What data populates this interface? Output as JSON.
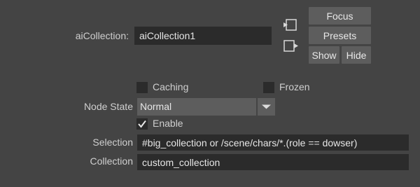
{
  "collection_name": {
    "label": "aiCollection:",
    "value": "aiCollection1"
  },
  "side_buttons": {
    "focus": "Focus",
    "presets": "Presets",
    "show": "Show",
    "hide": "Hide"
  },
  "checkboxes": {
    "caching": {
      "label": "Caching",
      "checked": false
    },
    "frozen": {
      "label": "Frozen",
      "checked": false
    },
    "enable": {
      "label": "Enable",
      "checked": true
    }
  },
  "node_state": {
    "label": "Node State",
    "value": "Normal"
  },
  "selection": {
    "label": "Selection",
    "value": "#big_collection or /scene/chars/*.(role == dowser)"
  },
  "collection": {
    "label": "Collection",
    "value": "custom_collection"
  },
  "icons": {
    "input_connection": "input-connection-icon",
    "output_connection": "output-connection-icon",
    "dropdown_arrow": "triangle-down-icon",
    "checkmark": "checkmark-icon"
  }
}
